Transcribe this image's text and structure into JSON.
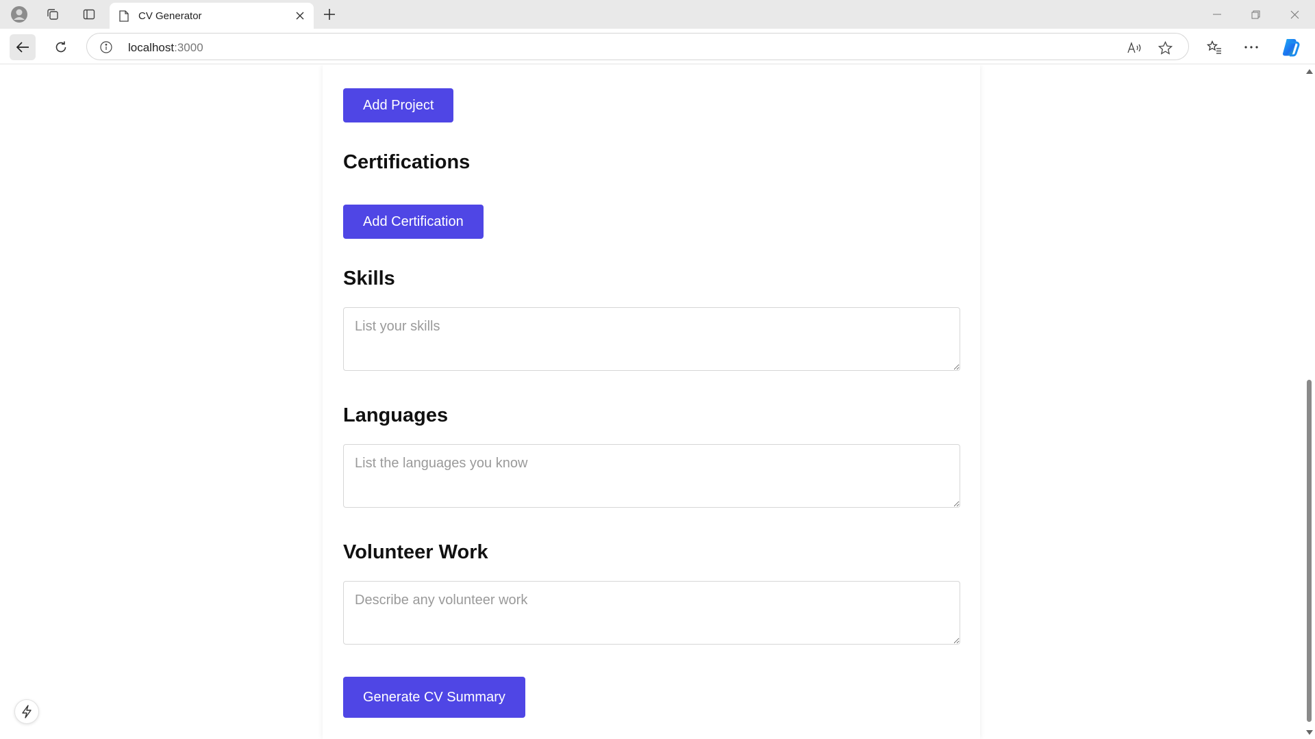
{
  "browser": {
    "tab_title": "CV Generator",
    "url_host": "localhost",
    "url_port": ":3000"
  },
  "form": {
    "add_project_label": "Add Project",
    "certifications_heading": "Certifications",
    "add_certification_label": "Add Certification",
    "skills_heading": "Skills",
    "skills_placeholder": "List your skills",
    "languages_heading": "Languages",
    "languages_placeholder": "List the languages you know",
    "volunteer_heading": "Volunteer Work",
    "volunteer_placeholder": "Describe any volunteer work",
    "generate_label": "Generate CV Summary"
  },
  "colors": {
    "primary": "#4f46e5",
    "copilot_blue": "#1c8cf0"
  },
  "icons": [
    "profile-icon",
    "collections-icon",
    "tab-actions-icon",
    "page-icon",
    "close-icon",
    "plus-icon",
    "minimize-icon",
    "restore-icon",
    "window-close-icon",
    "back-arrow-icon",
    "reload-icon",
    "info-icon",
    "read-aloud-icon",
    "favorite-star-icon",
    "favorites-icon",
    "more-icon",
    "copilot-icon",
    "bolt-icon"
  ]
}
